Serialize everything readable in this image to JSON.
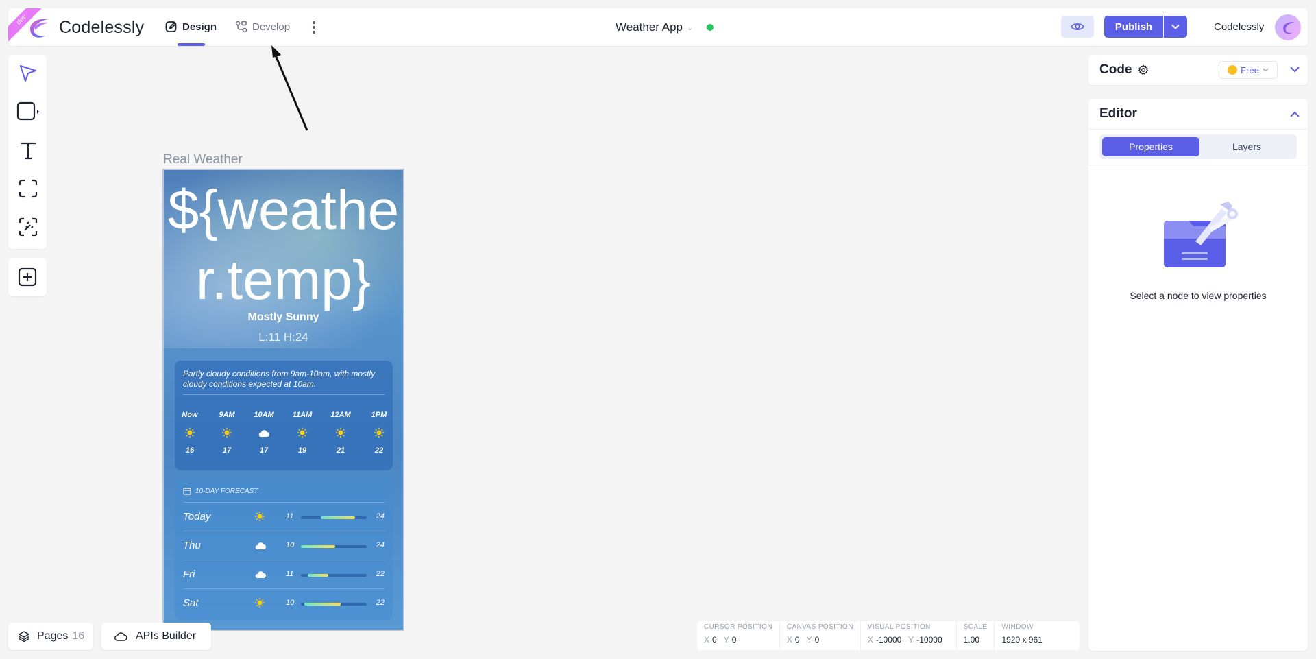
{
  "topbar": {
    "ribbon": "dev",
    "brand": "Codelessly",
    "tabs": {
      "design": "Design",
      "develop": "Develop"
    },
    "project": "Weather App",
    "publish": "Publish",
    "user": "Codelessly",
    "accent": "#5b5ee6",
    "status_color": "#22c55e"
  },
  "tools": [
    "select-icon",
    "rectangle-icon",
    "text-icon",
    "frame-icon",
    "magic-icon",
    "add-icon"
  ],
  "canvas": {
    "frame_label": "Real Weather",
    "temp": "${weather.temp}",
    "condition": "Mostly Sunny",
    "hilo": "L:11 H:24",
    "hourly_note": "Partly cloudy conditions from 9am-10am, with mostly cloudy conditions expected at 10am.",
    "hours": [
      {
        "time": "Now",
        "icon": "sun",
        "temp": "16"
      },
      {
        "time": "9AM",
        "icon": "sun",
        "temp": "17"
      },
      {
        "time": "10AM",
        "icon": "cloud",
        "temp": "17"
      },
      {
        "time": "11AM",
        "icon": "sun",
        "temp": "19"
      },
      {
        "time": "12AM",
        "icon": "sun",
        "temp": "21"
      },
      {
        "time": "1PM",
        "icon": "sun",
        "temp": "22"
      }
    ],
    "forecast_title": "10-DAY FORECAST",
    "forecast": [
      {
        "day": "Today",
        "icon": "sun",
        "lo": "11",
        "hi": "24",
        "bar_start": 0.3,
        "bar_end": 0.82
      },
      {
        "day": "Thu",
        "icon": "cloud",
        "lo": "10",
        "hi": "24",
        "bar_start": 0.0,
        "bar_end": 0.52
      },
      {
        "day": "Fri",
        "icon": "cloud",
        "lo": "11",
        "hi": "22",
        "bar_start": 0.1,
        "bar_end": 0.42
      },
      {
        "day": "Sat",
        "icon": "sun",
        "lo": "10",
        "hi": "22",
        "bar_start": 0.05,
        "bar_end": 0.6
      }
    ]
  },
  "bottom": {
    "pages_label": "Pages",
    "pages_count": "16",
    "apis_label": "APIs Builder"
  },
  "status": {
    "cursor_label": "CURSOR POSITION",
    "cursor_x": "0",
    "cursor_y": "0",
    "canvas_label": "CANVAS POSITION",
    "canvas_x": "0",
    "canvas_y": "0",
    "visual_label": "VISUAL POSITION",
    "visual_x": "-10000",
    "visual_y": "-10000",
    "scale_label": "SCALE",
    "scale": "1.00",
    "window_label": "WINDOW",
    "window": "1920 x 961",
    "x_key": "X",
    "y_key": "Y"
  },
  "right": {
    "code_title": "Code",
    "plan": "Free",
    "editor_title": "Editor",
    "tab_properties": "Properties",
    "tab_layers": "Layers",
    "empty_text": "Select a node to view properties"
  }
}
